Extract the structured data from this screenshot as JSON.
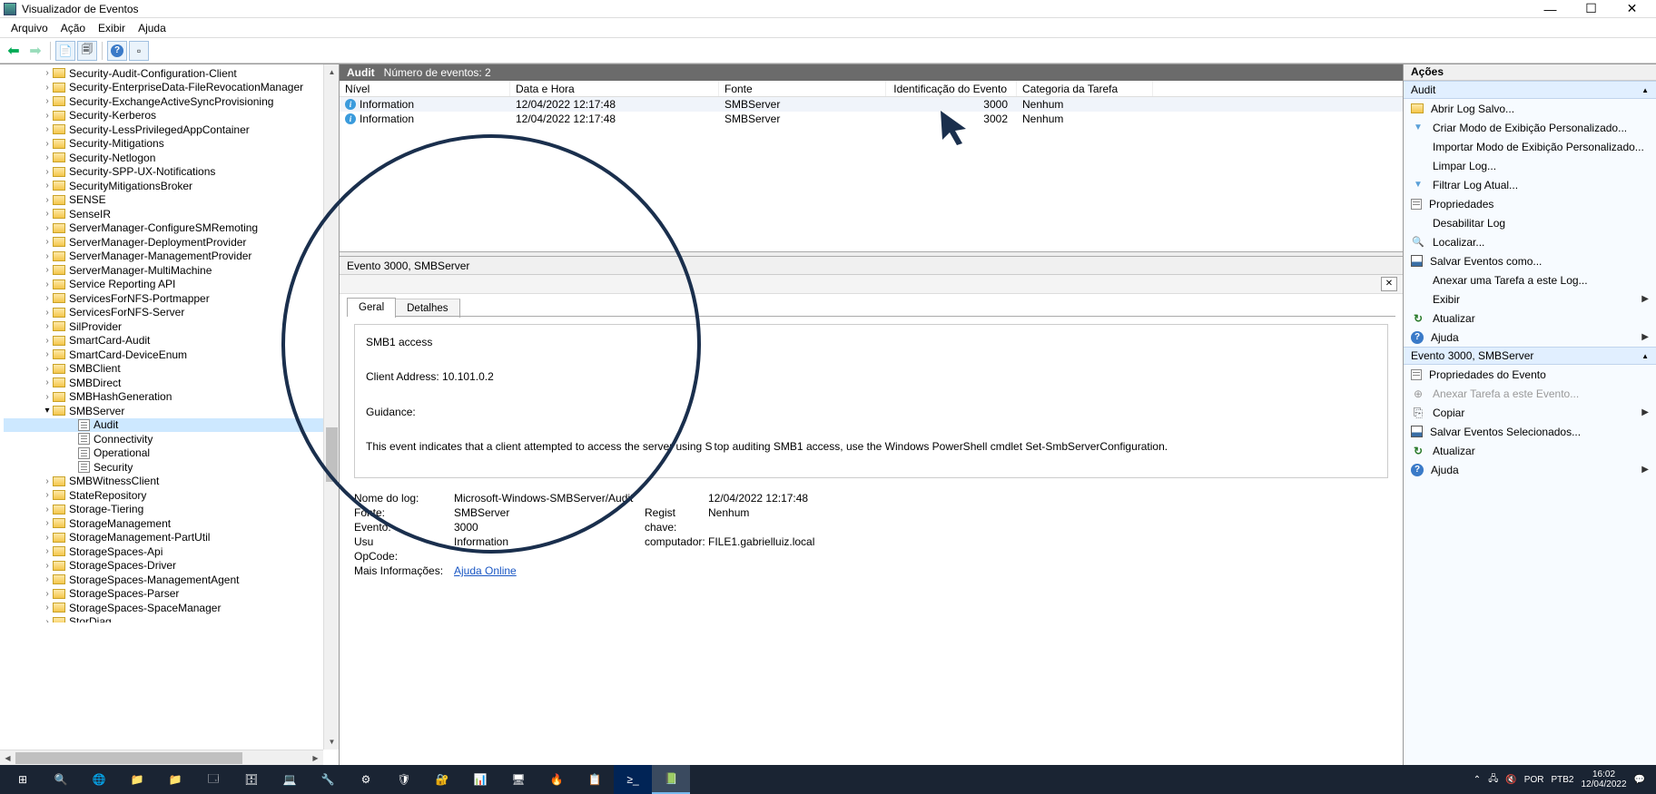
{
  "window": {
    "title": "Visualizador de Eventos"
  },
  "menu": {
    "file": "Arquivo",
    "action": "Ação",
    "view": "Exibir",
    "help": "Ajuda"
  },
  "tree": {
    "items": [
      "Security-Audit-Configuration-Client",
      "Security-EnterpriseData-FileRevocationManager",
      "Security-ExchangeActiveSyncProvisioning",
      "Security-Kerberos",
      "Security-LessPrivilegedAppContainer",
      "Security-Mitigations",
      "Security-Netlogon",
      "Security-SPP-UX-Notifications",
      "SecurityMitigationsBroker",
      "SENSE",
      "SenseIR",
      "ServerManager-ConfigureSMRemoting",
      "ServerManager-DeploymentProvider",
      "ServerManager-ManagementProvider",
      "ServerManager-MultiMachine",
      "Service Reporting API",
      "ServicesForNFS-Portmapper",
      "ServicesForNFS-Server",
      "SilProvider",
      "SmartCard-Audit",
      "SmartCard-DeviceEnum",
      "SMBClient",
      "SMBDirect",
      "SMBHashGeneration"
    ],
    "smbserver": "SMBServer",
    "children": [
      "Audit",
      "Connectivity",
      "Operational",
      "Security"
    ],
    "after": [
      "SMBWitnessClient",
      "StateRepository",
      "Storage-Tiering",
      "StorageManagement",
      "StorageManagement-PartUtil",
      "StorageSpaces-Api",
      "StorageSpaces-Driver",
      "StorageSpaces-ManagementAgent",
      "StorageSpaces-Parser",
      "StorageSpaces-SpaceManager",
      "StorDiag"
    ]
  },
  "center": {
    "log_name_bold": "Audit",
    "event_count": "Número de eventos: 2",
    "head": {
      "level": "Nível",
      "date": "Data e Hora",
      "source": "Fonte",
      "id": "Identificação do Evento",
      "cat": "Categoria da Tarefa"
    },
    "rows": [
      {
        "level": "Information",
        "date": "12/04/2022 12:17:48",
        "source": "SMBServer",
        "id": "3000",
        "cat": "Nenhum"
      },
      {
        "level": "Information",
        "date": "12/04/2022 12:17:48",
        "source": "SMBServer",
        "id": "3002",
        "cat": "Nenhum"
      }
    ],
    "detail_title": "Evento 3000, SMBServer",
    "tab_general": "Geral",
    "tab_details": "Detalhes",
    "msg_l1": "SMB1 access",
    "msg_l2": "Client Address: 10.101.0.2",
    "msg_l3": "Guidance:",
    "msg_l4_a": "This event indicates that a client attempted to access the server using S",
    "msg_l4_b": "top auditing SMB1 access, use the Windows PowerShell cmdlet Set-SmbServerConfiguration.",
    "props": {
      "log_lbl": "Nome do log:",
      "log_val": "Microsoft-Windows-SMBServer/Audit",
      "date_val": "12/04/2022 12:17:48",
      "src_lbl": "Fonte:",
      "src_val": "SMBServer",
      "cat_lbl": "Regist",
      "task_val": "Nenhum",
      "evt_lbl": "Evento:",
      "evt_val": "3000",
      "kw_lbl": "chave:",
      "usr_lbl": "Usu",
      "lvl_val": "Information",
      "comp_lbl": "computador:",
      "comp_val": "FILE1.gabrielluiz.local",
      "op_lbl": "OpCode:",
      "more_lbl": "Mais Informações:",
      "more_link": "Ajuda Online"
    }
  },
  "actions": {
    "header": "Ações",
    "section1": "Audit",
    "open_saved": "Abrir Log Salvo...",
    "create_view": "Criar Modo de Exibição Personalizado...",
    "import_view": "Importar Modo de Exibição Personalizado...",
    "clear_log": "Limpar Log...",
    "filter_log": "Filtrar Log Atual...",
    "properties": "Propriedades",
    "disable_log": "Desabilitar Log",
    "find": "Localizar...",
    "save_events": "Salvar Eventos como...",
    "attach_task": "Anexar uma Tarefa a este Log...",
    "view_menu": "Exibir",
    "refresh": "Atualizar",
    "help": "Ajuda",
    "section2": "Evento 3000, SMBServer",
    "event_props": "Propriedades do Evento",
    "attach_event": "Anexar Tarefa a este Evento...",
    "copy": "Copiar",
    "save_selected": "Salvar Eventos Selecionados...",
    "refresh2": "Atualizar",
    "help2": "Ajuda"
  },
  "taskbar": {
    "lang": "POR",
    "kbd": "PTB2",
    "time": "16:02",
    "date": "12/04/2022"
  }
}
